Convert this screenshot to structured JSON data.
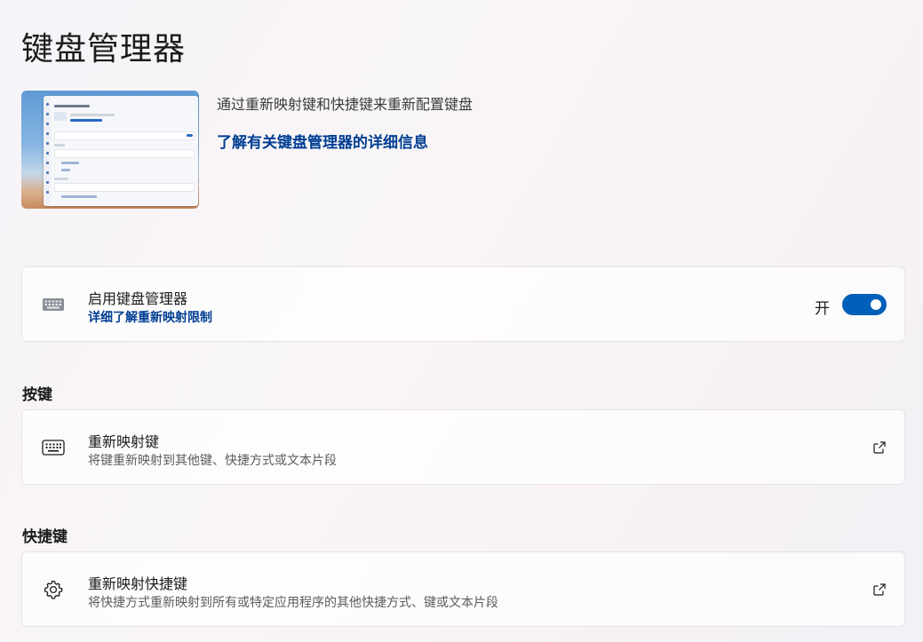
{
  "page": {
    "title": "键盘管理器"
  },
  "hero": {
    "description": "通过重新映射键和快捷键来重新配置键盘",
    "link": "了解有关键盘管理器的详细信息"
  },
  "enable": {
    "title": "启用键盘管理器",
    "link": "详细了解重新映射限制",
    "toggle_label": "开",
    "toggle_on": true,
    "accent": "#005fb8"
  },
  "keys_section": {
    "header": "按键",
    "remap_title": "重新映射键",
    "remap_desc": "将键重新映射到其他键、快捷方式或文本片段"
  },
  "shortcuts_section": {
    "header": "快捷键",
    "remap_title": "重新映射快捷键",
    "remap_desc": "将快捷方式重新映射到所有或特定应用程序的其他快捷方式、键或文本片段"
  },
  "icons": [
    "keyboard-icon",
    "keyboard-outline-icon",
    "gear-icon",
    "external-link-icon"
  ],
  "colors": {
    "link": "#003e92",
    "toggle": "#005fb8"
  }
}
